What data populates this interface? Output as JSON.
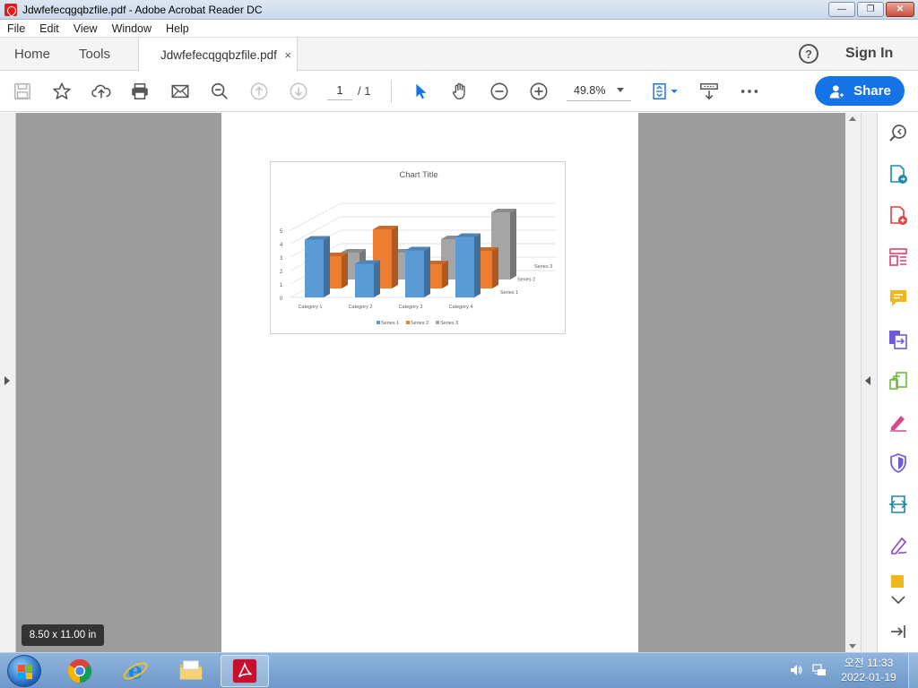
{
  "window": {
    "title": "Jdwfefecqgqbzfile.pdf - Adobe Acrobat Reader DC",
    "minimize_label": "—",
    "maximize_label": "❐",
    "close_label": "✕"
  },
  "menu": {
    "items": [
      "File",
      "Edit",
      "View",
      "Window",
      "Help"
    ]
  },
  "tabs": {
    "home": "Home",
    "tools": "Tools",
    "document": "Jdwfefecqgqbzfile.pdf",
    "close_glyph": "×"
  },
  "header": {
    "help_glyph": "?",
    "sign_in": "Sign In"
  },
  "toolbar": {
    "icons": [
      "save-icon",
      "bookmark-star-icon",
      "upload-icon",
      "print-icon",
      "email-icon",
      "zoom-search-icon",
      "prev-page-icon",
      "next-page-icon",
      "select-cursor-icon",
      "hand-icon",
      "zoom-out-icon",
      "zoom-in-icon",
      "fit-page-icon",
      "scroll-mode-icon",
      "more-icon"
    ],
    "page_current": "1",
    "page_total": "/ 1",
    "zoom": "49.8%",
    "share_label": "Share"
  },
  "colors": {
    "accent": "#1473e6",
    "series1": "#5b9bd5",
    "series2": "#ed7d31",
    "series3": "#a5a5a5"
  },
  "page_size_tooltip": "8.50 x 11.00 in",
  "right_panel": {
    "icons": [
      "search-zoom-icon",
      "export-pdf-icon",
      "create-pdf-icon",
      "organize-pages-icon",
      "comment-icon",
      "combine-files-icon",
      "compress-icon",
      "fill-sign-icon",
      "protect-icon",
      "send-review-icon",
      "sign-pen-icon",
      "more-tools-icon",
      "collapse-panel-icon"
    ]
  },
  "chart_data": {
    "type": "bar",
    "title": "Chart Title",
    "categories": [
      "Category 1",
      "Category 2",
      "Category 3",
      "Category 4"
    ],
    "series": [
      {
        "name": "Series 1",
        "values": [
          4.3,
          2.5,
          3.5,
          4.5
        ]
      },
      {
        "name": "Series 2",
        "values": [
          2.4,
          4.4,
          1.8,
          2.8
        ]
      },
      {
        "name": "Series 3",
        "values": [
          2,
          2,
          3,
          5
        ]
      }
    ],
    "yticks": [
      "0",
      "1",
      "2",
      "3",
      "4",
      "5"
    ],
    "ylim": [
      0,
      5
    ],
    "depth_labels": [
      "Series 1",
      "Series 2",
      "Series 3"
    ],
    "legend": [
      "Series 1",
      "Series 2",
      "Series 3"
    ],
    "legend_position": "bottom",
    "style": "3d-column",
    "grid": true
  },
  "taskbar": {
    "apps": [
      "chrome-icon",
      "internet-explorer-icon",
      "file-explorer-icon",
      "acrobat-reader-icon"
    ],
    "clock_time": "오전 11:33",
    "clock_date": "2022-01-19"
  }
}
